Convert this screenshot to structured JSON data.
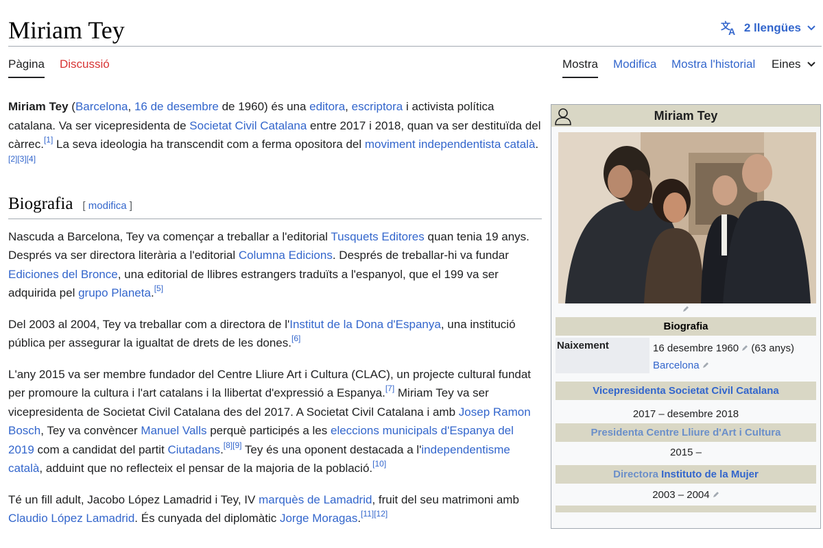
{
  "header": {
    "title": "Miriam Tey",
    "languages_label": "2 llengües"
  },
  "tabs": {
    "page": "Pàgina",
    "talk": "Discussió",
    "read": "Mostra",
    "edit": "Modifica",
    "history": "Mostra l'historial",
    "tools": "Eines"
  },
  "lead": {
    "name": "Miriam Tey",
    "t1": " (",
    "l_barcelona": "Barcelona",
    "t2": ", ",
    "l_date": "16 de desembre",
    "t3": " de 1960) és una ",
    "l_editora": "editora",
    "t4": ", ",
    "l_escriptora": "escriptora",
    "t5": " i activista política catalana. Va ser vicepresidenta de ",
    "l_scc": "Societat Civil Catalana",
    "t6": " entre 2017 i 2018, quan va ser destituïda del càrrec.",
    "r1": "[1]",
    "t7": " La seva ideologia ha transcendit com a ferma opositora del ",
    "l_moviment": "moviment independentista català",
    "t8": ".",
    "r2": "[2]",
    "r3": "[3]",
    "r4": "[4]"
  },
  "biografia": {
    "heading": "Biografia",
    "edit_open": "[ ",
    "edit_label": "modifica",
    "edit_close": " ]"
  },
  "p1": {
    "t1": "Nascuda a Barcelona, Tey va començar a treballar a l'editorial ",
    "l1": "Tusquets Editores",
    "t2": " quan tenia 19 anys. Després va ser directora literària a l'editorial ",
    "l2": "Columna Edicions",
    "t3": ". Després de treballar-hi va fundar ",
    "l3": "Ediciones del Bronce",
    "t4": ", una editorial de llibres estrangers traduïts a l'espanyol, que el 199 va ser adquirida pel ",
    "l4": "grupo Planeta",
    "t5": ".",
    "r5": "[5]"
  },
  "p2": {
    "t1": "Del 2003 al 2004, Tey va treballar com a directora de l'",
    "l1": "Institut de la Dona d'Espanya",
    "t2": ", una institució pública per assegurar la igualtat de drets de les dones.",
    "r6": "[6]"
  },
  "p3": {
    "t1": "L'any 2015 va ser membre fundador del Centre Lliure Art i Cultura (CLAC), un projecte cultural fundat per promoure la cultura i l'art catalans i la llibertat d'expressió a Espanya.",
    "r7": "[7]",
    "t2": " Miriam Tey va ser vicepresidenta de Societat Civil Catalana des del 2017. A Societat Civil Catalana i amb ",
    "l1": "Josep Ramon Bosch",
    "t3": ", Tey va convèncer ",
    "l2": "Manuel Valls",
    "t4": " perquè participés a les ",
    "l3": "eleccions municipals d'Espanya del 2019",
    "t5": " com a candidat del partit ",
    "l4": "Ciutadans",
    "t6": ".",
    "r8": "[8]",
    "r9": "[9]",
    "t7": " Tey és una oponent destacada a l'",
    "l5": "independentisme català",
    "t8": ", adduint que no reflecteix el pensar de la majoria de la població.",
    "r10": "[10]"
  },
  "p4": {
    "t1": "Té un fill adult, Jacobo López Lamadrid i Tey, IV ",
    "l1": "marquès de Lamadrid",
    "t2": ", fruit del seu matrimoni amb ",
    "l2": "Claudio López Lamadrid",
    "t3": ". És cunyada del diplomàtic ",
    "l3": "Jorge Moragas",
    "t4": ".",
    "r11": "[11]",
    "r12": "[12]"
  },
  "infobox": {
    "title": "Miriam Tey",
    "section_bio": "Biografia",
    "birth_label": "Naixement",
    "birth_value": "16 desembre 1960",
    "birth_age": " (63 anys)",
    "birth_place": "Barcelona",
    "role1": "Vicepresidenta Societat Civil Catalana",
    "role1_dates": "2017 – desembre 2018",
    "role2": "Presidenta Centre Lliure d'Art i Cultura",
    "role2_dates": "2015 –",
    "role3_a": "Directora",
    "role3_b": " Instituto de la Mujer",
    "role3_dates": "2003 – 2004"
  },
  "colors": {
    "link": "#3366cc",
    "redlink": "#d73333",
    "infobox_header": "#d9d7c5"
  }
}
